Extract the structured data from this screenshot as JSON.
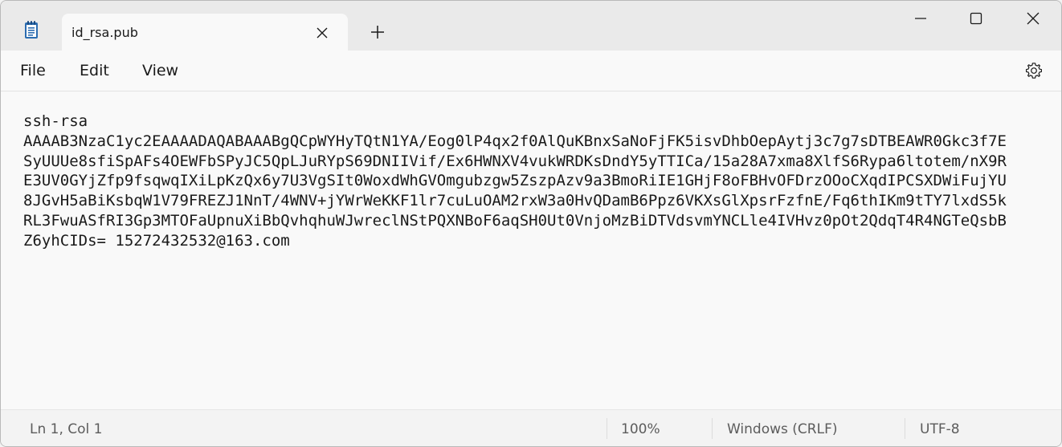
{
  "tab": {
    "title": "id_rsa.pub"
  },
  "menu": {
    "file": "File",
    "edit": "Edit",
    "view": "View"
  },
  "editor": {
    "lines": [
      "ssh-rsa",
      "AAAAB3NzaC1yc2EAAAADAQABAAABgQCpWYHyTQtN1YA/Eog0lP4qx2f0AlQuKBnxSaNoFjFK5isvDhbOepAytj3c7g7sDTBEAWR0Gkc3f7E",
      "SyUUUe8sfiSpAFs4OEWFbSPyJC5QpLJuRYpS69DNIIVif/Ex6HWNXV4vukWRDKsDndY5yTTICa/15a28A7xma8XlfS6Rypa6ltotem/nX9R",
      "E3UV0GYjZfp9fsqwqIXiLpKzQx6y7U3VgSIt0WoxdWhGVOmgubzgw5ZszpAzv9a3BmoRiIE1GHjF8oFBHvOFDrzOOoCXqdIPCSXDWiFujYU",
      "8JGvH5aBiKsbqW1V79FREZJ1NnT/4WNV+jYWrWeKKF1lr7cuLuOAM2rxW3a0HvQDamB6Ppz6VKXsGlXpsrFzfnE/Fq6thIKm9tTY7lxdS5k",
      "RL3FwuASfRI3Gp3MTOFaUpnuXiBbQvhqhuWJwreclNStPQXNBoF6aqSH0Ut0VnjoMzBiDTVdsvmYNCLle4IVHvz0pOt2QdqT4R4NGTeQsbB",
      "Z6yhCIDs= 15272432532@163.com"
    ]
  },
  "status": {
    "position": "Ln 1, Col 1",
    "zoom": "100%",
    "line_ending": "Windows (CRLF)",
    "encoding": "UTF-8"
  },
  "icons": {
    "app": "notepad-icon",
    "tab_close": "close-icon",
    "new_tab": "plus-icon",
    "minimize": "minimize-icon",
    "maximize": "maximize-icon",
    "close": "close-icon",
    "settings": "gear-icon"
  },
  "colors": {
    "app_icon": "#1a5fb4",
    "text": "#1a1a1a",
    "status_text": "#5c5c5c"
  }
}
